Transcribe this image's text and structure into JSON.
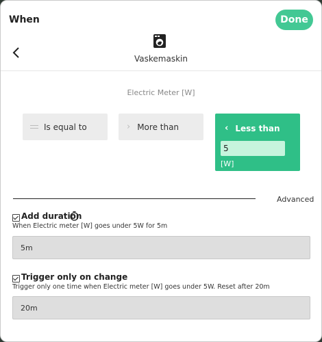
{
  "header": {
    "title": "When",
    "done_label": "Done"
  },
  "device": {
    "name": "Vaskemaskin",
    "icon": "washing-machine-icon"
  },
  "meter": {
    "label": "Electric Meter [W]"
  },
  "conditions": {
    "equal_label": "Is equal to",
    "more_label": "More than",
    "less_label": "Less than",
    "less_value": "5",
    "less_unit": "[W]",
    "selected": "Less than"
  },
  "advanced": {
    "label": "Advanced"
  },
  "duration": {
    "checked": true,
    "title": "Add duration",
    "description": "When Electric meter [W] goes under 5W for 5m",
    "value": "5m"
  },
  "trigger": {
    "checked": true,
    "title": "Trigger only on change",
    "description": "Trigger only one time when Electric meter [W] goes under 5W. Reset after 20m",
    "value": "20m"
  },
  "colors": {
    "accent": "#2fbf87",
    "done_button": "#43c894",
    "option_bg": "#ececec"
  }
}
